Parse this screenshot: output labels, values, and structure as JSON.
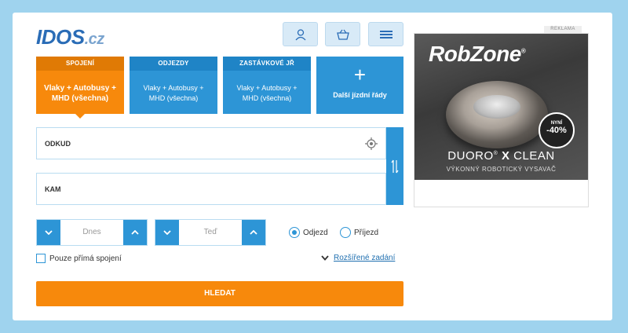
{
  "header": {
    "logo_main": "IDOS",
    "logo_suffix": ".cz",
    "buttons": [
      {
        "name": "user-button",
        "icon": "user-icon"
      },
      {
        "name": "basket-button",
        "icon": "basket-icon"
      },
      {
        "name": "menu-button",
        "icon": "hamburger-icon"
      }
    ]
  },
  "tabs": [
    {
      "title": "SPOJENÍ",
      "body": "Vlaky + Autobusy + MHD (všechna)",
      "active": true
    },
    {
      "title": "ODJEZDY",
      "body": "Vlaky + Autobusy + MHD (všechna)",
      "active": false
    },
    {
      "title": "ZASTÁVKOVÉ JŘ",
      "body": "Vlaky + Autobusy + MHD (všechna)",
      "active": false
    },
    {
      "plus": "+",
      "label": "Další jízdní řády"
    }
  ],
  "form": {
    "from_placeholder": "ODKUD",
    "to_placeholder": "KAM",
    "date_value": "Dnes",
    "time_value": "Teď",
    "radio_depart": "Odjezd",
    "radio_arrive": "Příjezd",
    "direct_only": "Pouze přímá spojení",
    "advanced": "Rozšířené zadání",
    "search": "HLEDAT"
  },
  "ad": {
    "label": "REKLAMA",
    "brand": "RobZone",
    "brand_mark": "®",
    "product_light": "DUORO",
    "product_mark": "®",
    "product_bold": "X",
    "product_rest": "CLEAN",
    "tagline": "VÝKONNÝ ROBOTICKÝ VYSAVAČ",
    "sale_top": "NYNÍ",
    "sale_value": "-40%"
  },
  "colors": {
    "accent_blue": "#2d95d6",
    "accent_orange": "#f7890c",
    "background": "#9fd3ee"
  }
}
